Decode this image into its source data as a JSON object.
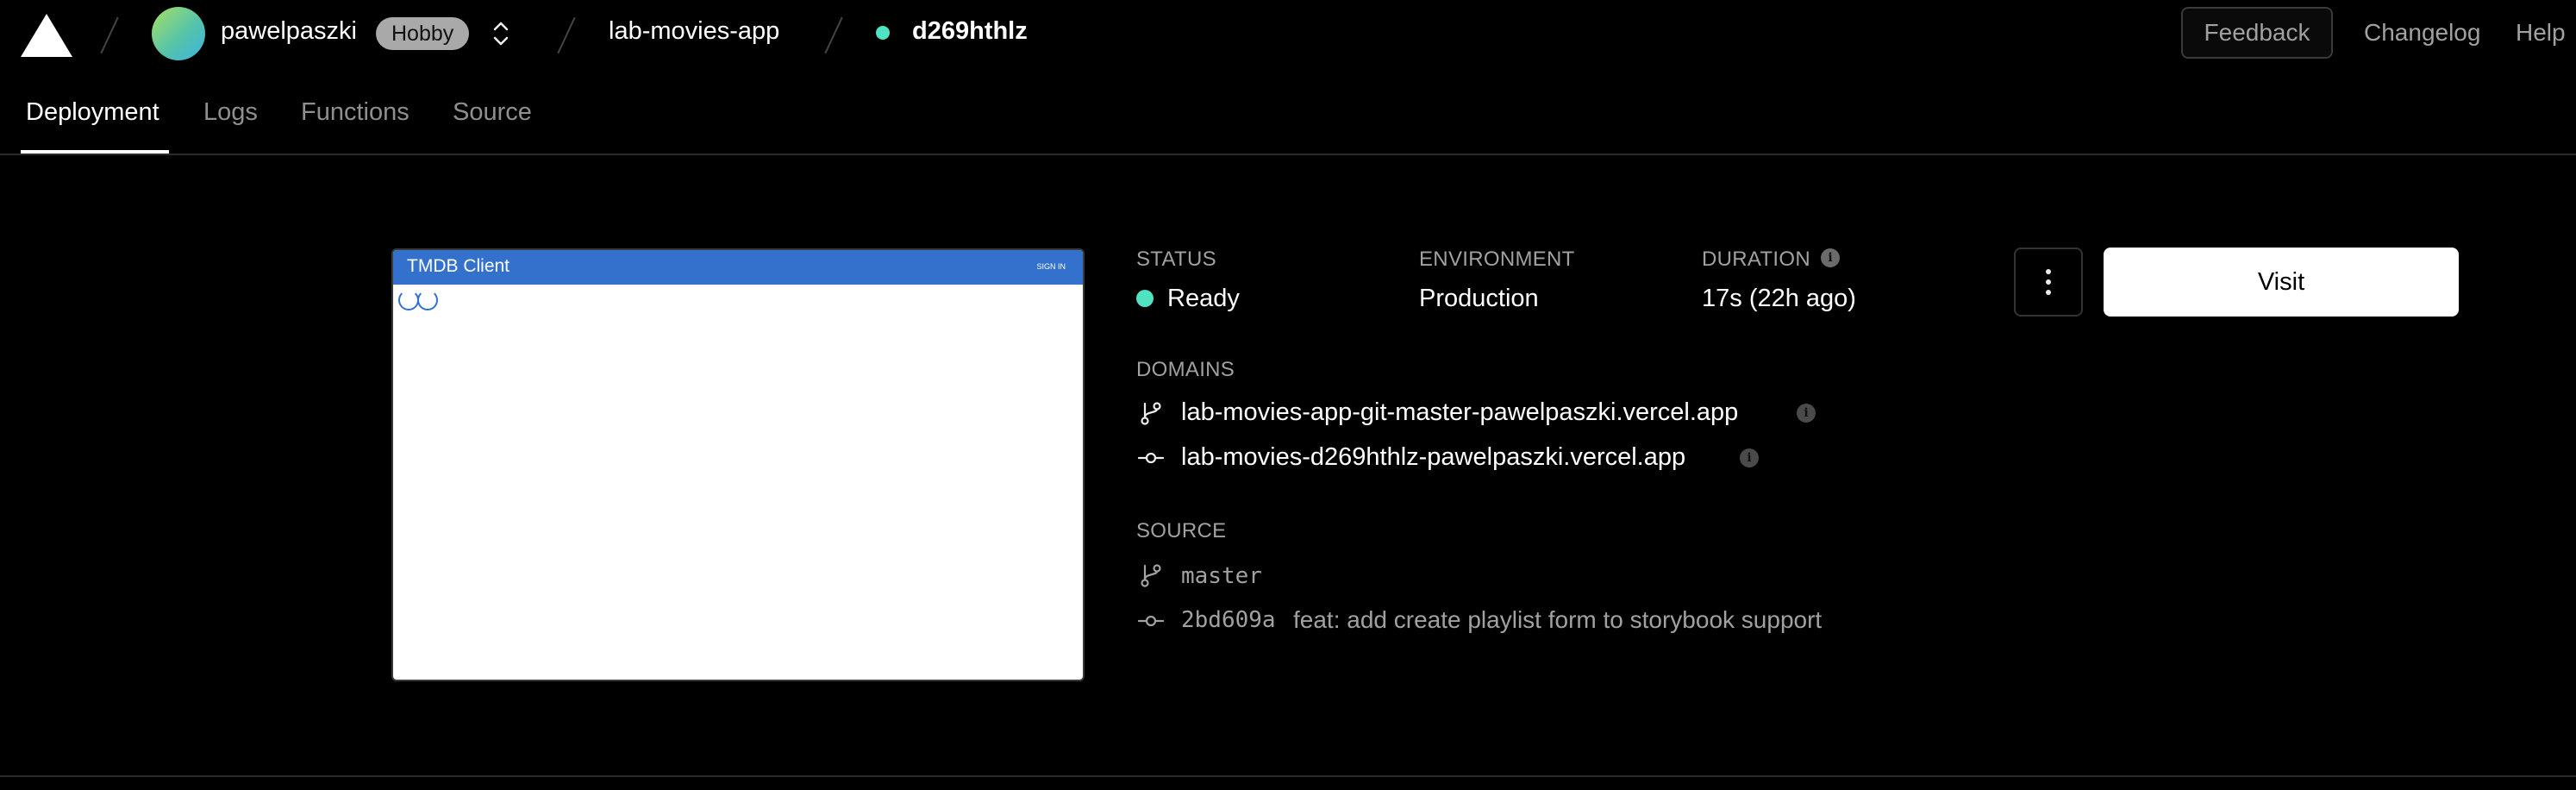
{
  "header": {
    "team_name": "pawelpaszki",
    "plan_badge": "Hobby",
    "project_name": "lab-movies-app",
    "deployment_id": "d269hthlz",
    "feedback_label": "Feedback",
    "changelog_label": "Changelog",
    "help_label": "Help"
  },
  "tabs": [
    {
      "label": "Deployment",
      "active": true
    },
    {
      "label": "Logs",
      "active": false
    },
    {
      "label": "Functions",
      "active": false
    },
    {
      "label": "Source",
      "active": false
    }
  ],
  "preview": {
    "app_title": "TMDB Client",
    "sign_in": "SIGN IN"
  },
  "info": {
    "status_label": "STATUS",
    "status_value": "Ready",
    "environment_label": "ENVIRONMENT",
    "environment_value": "Production",
    "duration_label": "DURATION",
    "duration_value": "17s (22h ago)",
    "domains_label": "DOMAINS",
    "domains": [
      "lab-movies-app-git-master-pawelpaszki.vercel.app",
      "lab-movies-d269hthlz-pawelpaszki.vercel.app"
    ],
    "source_label": "SOURCE",
    "branch": "master",
    "commit_sha": "2bd609a",
    "commit_message": "feat: add create playlist form to storybook support"
  },
  "actions": {
    "visit_label": "Visit"
  },
  "colors": {
    "ready": "#50e3c2",
    "preview_appbar": "#3471cc"
  }
}
